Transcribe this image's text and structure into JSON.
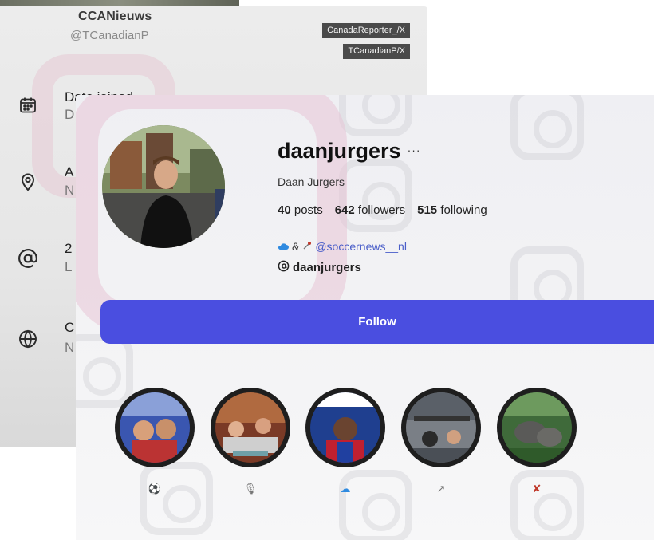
{
  "twitter_card": {
    "display_name": "CCANieuws",
    "handle": "@TCanadianP",
    "tags": [
      "CanadaReporter_/X",
      "TCanadianP/X"
    ],
    "rows": [
      {
        "icon": "calendar-icon",
        "title": "Date joined",
        "sub": "D"
      },
      {
        "icon": "location-pin-icon",
        "title": "A",
        "sub": "N"
      },
      {
        "icon": "at-sign-icon",
        "title": "2",
        "sub": "L"
      },
      {
        "icon": "globe-icon",
        "title": "C",
        "sub": "N"
      }
    ]
  },
  "instagram_profile": {
    "username": "daanjurgers",
    "more": "···",
    "full_name": "Daan Jurgers",
    "stats": {
      "posts_count": "40",
      "posts_label": "posts",
      "followers_count": "642",
      "followers_label": "followers",
      "following_count": "515",
      "following_label": "following"
    },
    "bio": {
      "prefix": "&",
      "link": "@soccernews__nl"
    },
    "threads_handle": "daanjurgers",
    "follow_label": "Follow",
    "accent_color": "#4a4ee0",
    "highlights": [
      {
        "label": "⚽",
        "label_color": "#222"
      },
      {
        "label": "🎙",
        "label_color": "#777"
      },
      {
        "label": "☁",
        "label_color": "#2f8ae0"
      },
      {
        "label": "↗",
        "label_color": "#777"
      },
      {
        "label": "✘",
        "label_color": "#c0392b"
      }
    ]
  }
}
